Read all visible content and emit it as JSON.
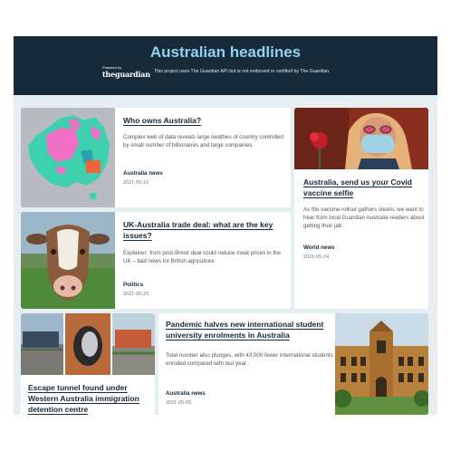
{
  "header": {
    "title": "Australian headlines",
    "powered_by": "Powered by",
    "brand": "theguardian",
    "disclaimer": "This project uses The Guardian API but is not endorsed or certified by The Guardian."
  },
  "articles": [
    {
      "title": "Who owns Australia?",
      "description": "Complex web of data reveals large swathes of country controlled by small number of billionaires and large companies.",
      "section": "Australia news",
      "date": "2021-05-16",
      "image": "australia-ownership-map"
    },
    {
      "title": "Australia, send us your Covid vaccine selfie",
      "description": "As the vaccine rollout gathers steam, we want to hear from local Guardian Australia readers about getting their jab.",
      "section": "World news",
      "date": "2021-05-24",
      "image": "masked-woman-with-flower"
    },
    {
      "title": "UK-Australia trade deal: what are the key issues?",
      "description": "Explainer: from post-Brexit deal could reduce meat prices in the UK – bad news for British agriculture.",
      "section": "Politics",
      "date": "2021-05-20",
      "image": "cow-portrait"
    },
    {
      "title": "Pandemic halves new international student university enrolments in Australia",
      "description": "Total number also plunges, with 43,000 fewer international students enrolled compared with last year .",
      "section": "Australia news",
      "date": "2021-05-05",
      "image": "university-sandstone-building"
    },
    {
      "title": "Escape tunnel found under Western Australia immigration detention centre",
      "description": "",
      "section": "",
      "date": "",
      "image": "detention-centre-collage"
    }
  ],
  "colors": {
    "header_bg": "#172a3a",
    "title_accent": "#8fd3ef",
    "page_bg": "#e7eef1",
    "card_bg": "#ffffff"
  }
}
